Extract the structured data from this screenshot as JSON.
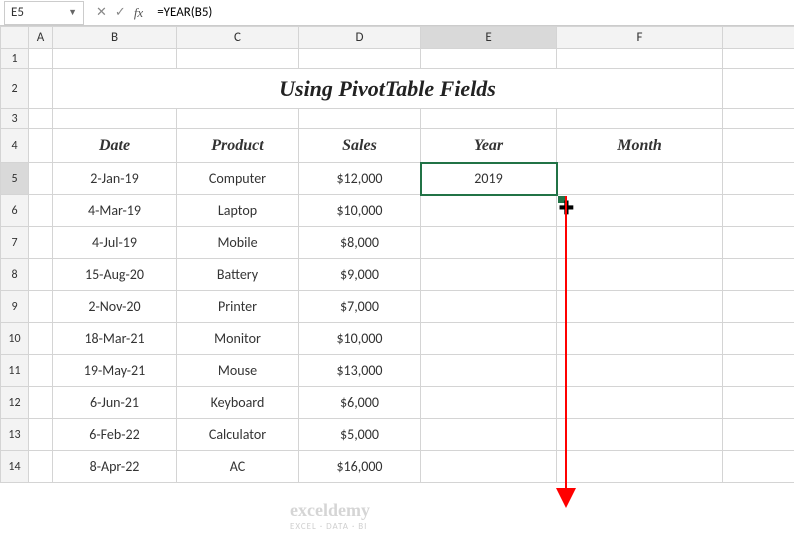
{
  "name_box": "E5",
  "formula": "=YEAR(B5)",
  "columns": [
    "A",
    "B",
    "C",
    "D",
    "E",
    "F"
  ],
  "rows": [
    "1",
    "2",
    "3",
    "4",
    "5",
    "6",
    "7",
    "8",
    "9",
    "10",
    "11",
    "12",
    "13",
    "14"
  ],
  "title": "Using PivotTable Fields",
  "headers": {
    "date": "Date",
    "product": "Product",
    "sales": "Sales",
    "year": "Year",
    "month": "Month"
  },
  "data": [
    {
      "date": "2-Jan-19",
      "product": "Computer",
      "sales": "$12,000",
      "year": "2019",
      "month": ""
    },
    {
      "date": "4-Mar-19",
      "product": "Laptop",
      "sales": "$10,000",
      "year": "",
      "month": ""
    },
    {
      "date": "4-Jul-19",
      "product": "Mobile",
      "sales": "$8,000",
      "year": "",
      "month": ""
    },
    {
      "date": "15-Aug-20",
      "product": "Battery",
      "sales": "$9,000",
      "year": "",
      "month": ""
    },
    {
      "date": "2-Nov-20",
      "product": "Printer",
      "sales": "$7,000",
      "year": "",
      "month": ""
    },
    {
      "date": "18-Mar-21",
      "product": "Monitor",
      "sales": "$10,000",
      "year": "",
      "month": ""
    },
    {
      "date": "19-May-21",
      "product": "Mouse",
      "sales": "$13,000",
      "year": "",
      "month": ""
    },
    {
      "date": "6-Jun-21",
      "product": "Keyboard",
      "sales": "$6,000",
      "year": "",
      "month": ""
    },
    {
      "date": "6-Feb-22",
      "product": "Calculator",
      "sales": "$5,000",
      "year": "",
      "month": ""
    },
    {
      "date": "8-Apr-22",
      "product": "AC",
      "sales": "$16,000",
      "year": "",
      "month": ""
    }
  ],
  "watermark": {
    "brand": "exceldemy",
    "sub": "EXCEL · DATA · BI"
  },
  "chart_data": {
    "type": "table",
    "title": "Using PivotTable Fields",
    "columns": [
      "Date",
      "Product",
      "Sales",
      "Year",
      "Month"
    ],
    "rows": [
      [
        "2-Jan-19",
        "Computer",
        12000,
        2019,
        null
      ],
      [
        "4-Mar-19",
        "Laptop",
        10000,
        null,
        null
      ],
      [
        "4-Jul-19",
        "Mobile",
        8000,
        null,
        null
      ],
      [
        "15-Aug-20",
        "Battery",
        9000,
        null,
        null
      ],
      [
        "2-Nov-20",
        "Printer",
        7000,
        null,
        null
      ],
      [
        "18-Mar-21",
        "Monitor",
        10000,
        null,
        null
      ],
      [
        "19-May-21",
        "Mouse",
        13000,
        null,
        null
      ],
      [
        "6-Jun-21",
        "Keyboard",
        6000,
        null,
        null
      ],
      [
        "6-Feb-22",
        "Calculator",
        5000,
        null,
        null
      ],
      [
        "8-Apr-22",
        "AC",
        16000,
        null,
        null
      ]
    ]
  }
}
